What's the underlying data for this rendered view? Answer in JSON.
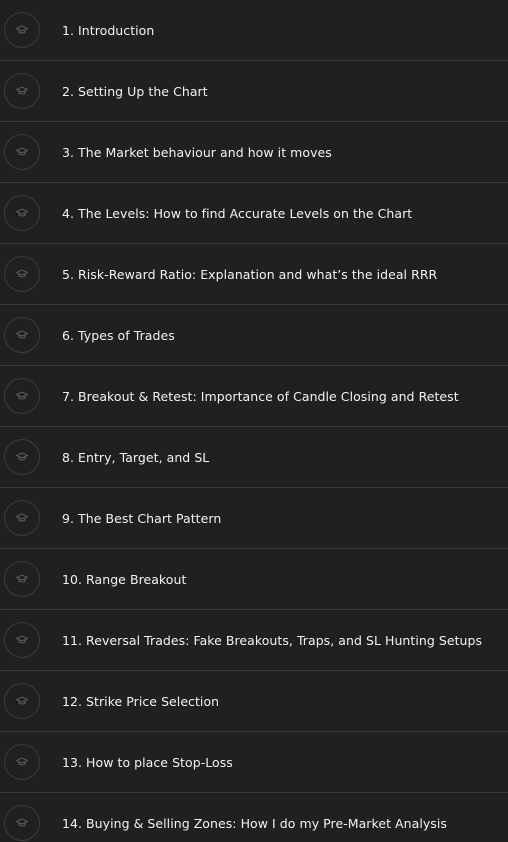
{
  "lessons": [
    {
      "title": "1. Introduction",
      "icon": "graduation-cap-icon"
    },
    {
      "title": "2. Setting Up the Chart",
      "icon": "graduation-cap-icon"
    },
    {
      "title": "3. The Market behaviour and how it moves",
      "icon": "graduation-cap-icon"
    },
    {
      "title": "4. The Levels: How to find Accurate Levels on the Chart",
      "icon": "graduation-cap-icon"
    },
    {
      "title": "5. Risk-Reward Ratio: Explanation and what’s the ideal RRR",
      "icon": "graduation-cap-icon"
    },
    {
      "title": "6. Types of Trades",
      "icon": "graduation-cap-icon"
    },
    {
      "title": "7. Breakout & Retest: Importance of Candle Closing and Retest",
      "icon": "graduation-cap-icon"
    },
    {
      "title": "8. Entry, Target, and SL",
      "icon": "graduation-cap-icon"
    },
    {
      "title": "9. The Best Chart Pattern",
      "icon": "graduation-cap-icon"
    },
    {
      "title": "10. Range Breakout",
      "icon": "graduation-cap-icon"
    },
    {
      "title": "11. Reversal Trades: Fake Breakouts, Traps, and SL Hunting Setups",
      "icon": "graduation-cap-icon"
    },
    {
      "title": "12. Strike Price Selection",
      "icon": "graduation-cap-icon"
    },
    {
      "title": "13. How to place Stop-Loss",
      "icon": "graduation-cap-icon"
    },
    {
      "title": "14. Buying & Selling Zones: How I do my Pre-Market Analysis",
      "icon": "graduation-cap-icon"
    }
  ],
  "colors": {
    "background": "#202020",
    "divider": "#3a3a3a",
    "text": "#f3f3f3",
    "icon": "#6a6a6a"
  }
}
